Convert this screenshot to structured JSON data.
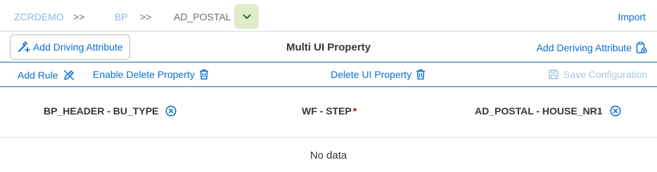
{
  "breadcrumb": {
    "items": [
      {
        "label": "ZCRDEMO",
        "type": "link"
      },
      {
        "label": ">>",
        "type": "sep"
      },
      {
        "label": "BP",
        "type": "link"
      },
      {
        "label": ">>",
        "type": "sep"
      },
      {
        "label": "AD_POSTAL",
        "type": "current"
      }
    ]
  },
  "toolbar": {
    "import_label": "Import",
    "add_driving_label": "Add Driving Attribute",
    "title": "Multi UI Property",
    "add_deriving_label": "Add Deriving Attribute"
  },
  "actions": {
    "add_rule": "Add Rule",
    "enable_delete": "Enable Delete Property",
    "delete_ui": "Delete UI Property",
    "save_config": "Save Configuration"
  },
  "table": {
    "columns": [
      {
        "label": "BP_HEADER - BU_TYPE",
        "clearable": true,
        "required": false
      },
      {
        "label": "WF - STEP",
        "clearable": false,
        "required": true
      },
      {
        "label": "AD_POSTAL - HOUSE_NR1",
        "clearable": true,
        "required": false
      }
    ],
    "required_marker": "*",
    "empty_text": "No data"
  },
  "colors": {
    "accent": "#0a6ed1",
    "disabled": "#a9c5e3",
    "dropdown_bg": "#e0ecc9",
    "required": "#bb0000"
  }
}
